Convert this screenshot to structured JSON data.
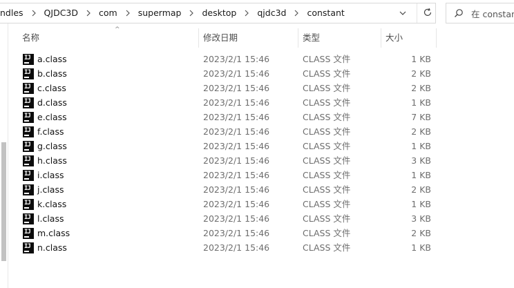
{
  "breadcrumb": {
    "items": [
      "ndles",
      "QJDC3D",
      "com",
      "supermap",
      "desktop",
      "qjdc3d",
      "constant"
    ]
  },
  "address_bar": {
    "dropdown_icon": "chevron-down-icon",
    "refresh_icon": "refresh-icon"
  },
  "search": {
    "placeholder": "在 constant",
    "icon": "search-icon"
  },
  "columns": {
    "name": "名称",
    "date": "修改日期",
    "type": "类型",
    "size": "大小"
  },
  "files": [
    {
      "name": "a.class",
      "date": "2023/2/1 15:46",
      "type": "CLASS 文件",
      "size": "1 KB"
    },
    {
      "name": "b.class",
      "date": "2023/2/1 15:46",
      "type": "CLASS 文件",
      "size": "2 KB"
    },
    {
      "name": "c.class",
      "date": "2023/2/1 15:46",
      "type": "CLASS 文件",
      "size": "2 KB"
    },
    {
      "name": "d.class",
      "date": "2023/2/1 15:46",
      "type": "CLASS 文件",
      "size": "1 KB"
    },
    {
      "name": "e.class",
      "date": "2023/2/1 15:46",
      "type": "CLASS 文件",
      "size": "7 KB"
    },
    {
      "name": "f.class",
      "date": "2023/2/1 15:46",
      "type": "CLASS 文件",
      "size": "2 KB"
    },
    {
      "name": "g.class",
      "date": "2023/2/1 15:46",
      "type": "CLASS 文件",
      "size": "1 KB"
    },
    {
      "name": "h.class",
      "date": "2023/2/1 15:46",
      "type": "CLASS 文件",
      "size": "3 KB"
    },
    {
      "name": "i.class",
      "date": "2023/2/1 15:46",
      "type": "CLASS 文件",
      "size": "1 KB"
    },
    {
      "name": "j.class",
      "date": "2023/2/1 15:46",
      "type": "CLASS 文件",
      "size": "2 KB"
    },
    {
      "name": "k.class",
      "date": "2023/2/1 15:46",
      "type": "CLASS 文件",
      "size": "1 KB"
    },
    {
      "name": "l.class",
      "date": "2023/2/1 15:46",
      "type": "CLASS 文件",
      "size": "3 KB"
    },
    {
      "name": "m.class",
      "date": "2023/2/1 15:46",
      "type": "CLASS 文件",
      "size": "2 KB"
    },
    {
      "name": "n.class",
      "date": "2023/2/1 15:46",
      "type": "CLASS 文件",
      "size": "1 KB"
    }
  ]
}
